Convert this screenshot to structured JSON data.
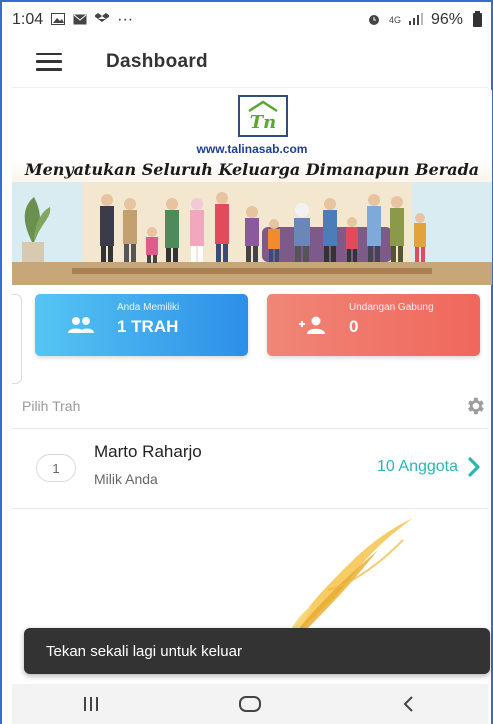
{
  "status_bar": {
    "time": "1:04",
    "extra": "···",
    "network": "4G",
    "battery": "96%"
  },
  "app_bar": {
    "title": "Dashboard"
  },
  "banner": {
    "logo_text": "Tn",
    "url": "www.talinasab.com",
    "tagline": "Menyatukan Seluruh Keluarga Dimanapun Berada"
  },
  "cards": {
    "owned": {
      "caption": "Anda Memiliki",
      "value": "1 TRAH",
      "icon": "group-icon"
    },
    "invite": {
      "caption": "Undangan Gabung",
      "value": "0",
      "icon": "add-person-icon"
    }
  },
  "section": {
    "label": "Pilih Trah",
    "settings_icon": "gear-icon"
  },
  "trah_list": [
    {
      "index": "1",
      "name": "Marto Raharjo",
      "subtitle": "Milik Anda",
      "members": "10 Anggota"
    }
  ],
  "toast": {
    "message": "Tekan sekali lagi untuk keluar"
  },
  "colors": {
    "accent_teal": "#2bb6b6",
    "card_blue": "#2d8fe8",
    "card_red": "#f0675c",
    "toast_bg": "#333333"
  }
}
